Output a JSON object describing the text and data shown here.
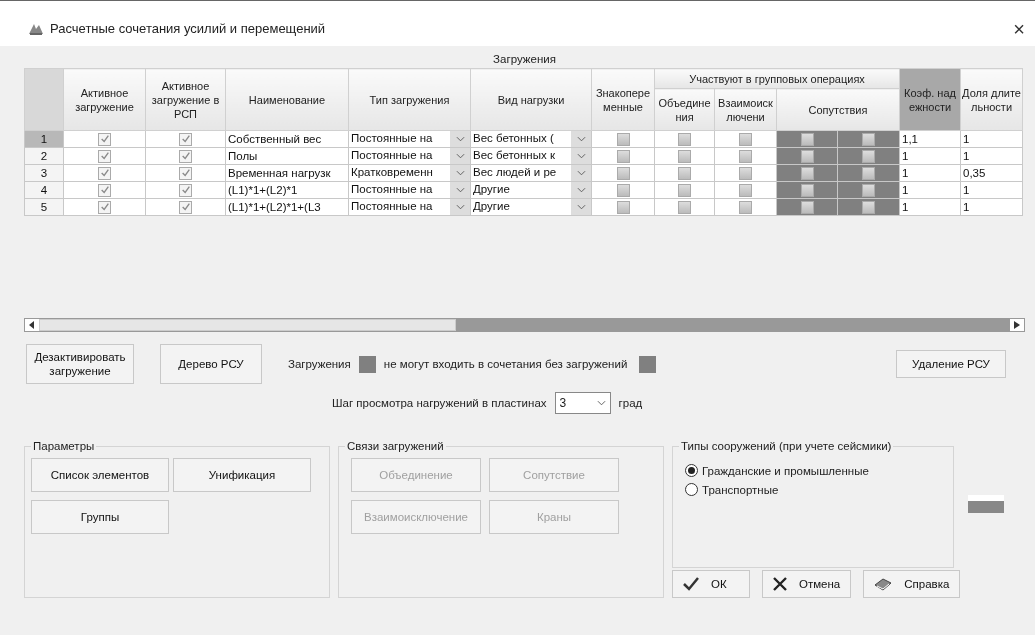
{
  "window": {
    "title": "Расчетные сочетания усилий и перемещений",
    "close": "×"
  },
  "table": {
    "caption": "Загружения",
    "group_header": "Участвуют в групповых операциях",
    "columns": [
      "Активное загружение",
      "Активное загружение в РСП",
      "Наименование",
      "Тип загружения",
      "Вид нагрузки",
      "Знакопеременные",
      "Объединения",
      "Взаимоисключени",
      "Сопутствия",
      "Коэф. надежности",
      "Доля длительности"
    ],
    "rows": [
      {
        "number": "1",
        "selected": true,
        "active": true,
        "active_rsp": true,
        "name": "Собственный вес",
        "type": "Постоянные на",
        "load_kind": "Вес бетонных (",
        "alternating": false,
        "union": false,
        "exclusion": false,
        "accompany": [
          false,
          false
        ],
        "factor": "1,1",
        "duration": "1"
      },
      {
        "number": "2",
        "selected": false,
        "active": true,
        "active_rsp": true,
        "name": "Полы",
        "type": "Постоянные на",
        "load_kind": "Вес бетонных к",
        "alternating": false,
        "union": false,
        "exclusion": false,
        "accompany": [
          false,
          false
        ],
        "factor": "1",
        "duration": "1"
      },
      {
        "number": "3",
        "selected": false,
        "active": true,
        "active_rsp": true,
        "name": "Временная нагрузк",
        "type": "Кратковременн",
        "load_kind": "Вес людей и ре",
        "alternating": false,
        "union": false,
        "exclusion": false,
        "accompany": [
          false,
          false
        ],
        "factor": "1",
        "duration": "0,35"
      },
      {
        "number": "4",
        "selected": false,
        "active": true,
        "active_rsp": true,
        "name": "(L1)*1+(L2)*1",
        "type": "Постоянные на",
        "load_kind": "Другие",
        "alternating": false,
        "union": false,
        "exclusion": false,
        "accompany": [
          false,
          false
        ],
        "factor": "1",
        "duration": "1"
      },
      {
        "number": "5",
        "selected": false,
        "active": true,
        "active_rsp": true,
        "name": "(L1)*1+(L2)*1+(L3",
        "type": "Постоянные на",
        "load_kind": "Другие",
        "alternating": false,
        "union": false,
        "exclusion": false,
        "accompany": [
          false,
          false
        ],
        "factor": "1",
        "duration": "1"
      }
    ]
  },
  "actions": {
    "deactivate": "Дезактивировать загружение",
    "tree": "Дерево РСУ",
    "legend_loads": "Загружения",
    "legend_text": "не могут входить в сочетания без загружений",
    "delete": "Удаление РСУ"
  },
  "step": {
    "label": "Шаг просмотра нагружений в пластинах",
    "value": "3",
    "unit": "град"
  },
  "groups": [
    {
      "title": "Параметры",
      "buttons": [
        {
          "label": "Список элементов",
          "disabled": false
        },
        {
          "label": "Унификация",
          "disabled": false
        },
        {
          "label": "Группы",
          "disabled": false
        }
      ]
    },
    {
      "title": "Связи загружений",
      "buttons": [
        {
          "label": "Объединение",
          "disabled": true
        },
        {
          "label": "Сопутствие",
          "disabled": true
        },
        {
          "label": "Взаимоисключение",
          "disabled": true
        },
        {
          "label": "Краны",
          "disabled": true
        }
      ]
    }
  ],
  "structure_types": {
    "title": "Типы сооружений (при учете сейсмики)",
    "options": [
      {
        "label": "Гражданские и промышленные",
        "selected": true
      },
      {
        "label": "Транспортные",
        "selected": false
      }
    ]
  },
  "dialog_buttons": [
    {
      "kind": "ok",
      "label": "ОК"
    },
    {
      "kind": "cancel",
      "label": "Отмена"
    },
    {
      "kind": "help",
      "label": "Справка"
    }
  ]
}
